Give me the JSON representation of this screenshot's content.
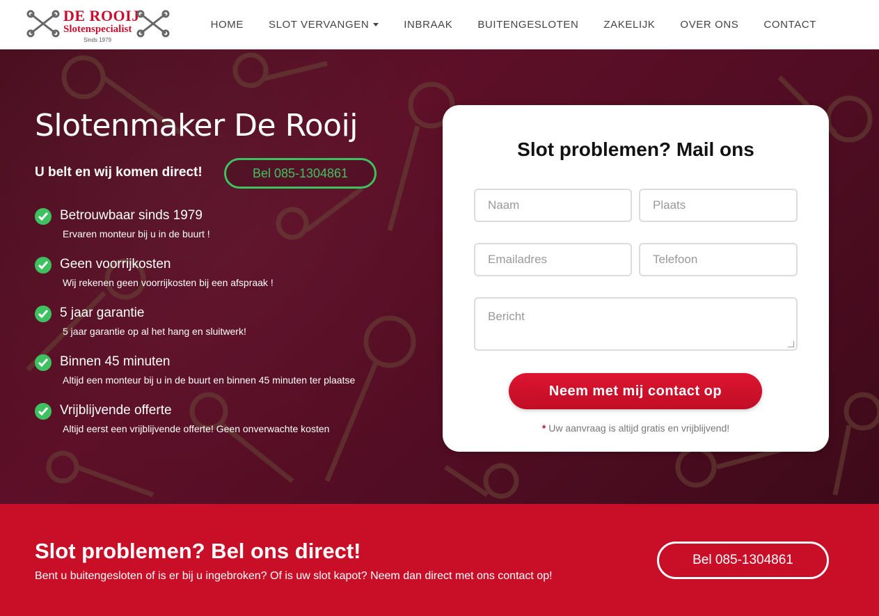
{
  "brand": {
    "name": "DE ROOIJ",
    "subtitle": "Slotenspecialist",
    "since": "Sinds 1979",
    "color": "#c8102e"
  },
  "nav": {
    "items": [
      {
        "label": "HOME"
      },
      {
        "label": "SLOT VERVANGEN",
        "has_dropdown": true
      },
      {
        "label": "INBRAAK"
      },
      {
        "label": "BUITENGESLOTEN"
      },
      {
        "label": "ZAKELIJK"
      },
      {
        "label": "OVER ONS"
      },
      {
        "label": "CONTACT"
      }
    ]
  },
  "hero": {
    "title": "Slotenmaker De Rooij",
    "call_text": "U belt en wij komen direct!",
    "call_button": "Bel 085-1304861",
    "accent_color": "#3ec261",
    "features": [
      {
        "title": "Betrouwbaar sinds 1979",
        "subtitle": "Ervaren monteur bij u in de buurt !"
      },
      {
        "title": "Geen voorrijkosten",
        "subtitle": "Wij rekenen geen voorrijkosten bij een afspraak !"
      },
      {
        "title": "5 jaar garantie",
        "subtitle": "5 jaar garantie op al het hang en sluitwerk!"
      },
      {
        "title": "Binnen 45 minuten",
        "subtitle": "Altijd een monteur bij u in de buurt en binnen 45 minuten ter plaatse"
      },
      {
        "title": "Vrijblijvende offerte",
        "subtitle": "Altijd eerst een vrijblijvende offerte! Geen onverwachte kosten"
      }
    ]
  },
  "form": {
    "title": "Slot problemen? Mail ons",
    "name_placeholder": "Naam",
    "city_placeholder": "Plaats",
    "email_placeholder": "Emailadres",
    "phone_placeholder": "Telefoon",
    "message_placeholder": "Bericht",
    "submit_label": "Neem met mij contact op",
    "note_star": "*",
    "note": "Uw aanvraag is altijd gratis en vrijblijvend!"
  },
  "cta": {
    "title": "Slot problemen? Bel ons direct!",
    "subtitle": "Bent u buitengesloten of is er bij u ingebroken? Of is uw slot kapot? Neem dan direct met ons contact op!",
    "button": "Bel 085-1304861",
    "background": "#c90f28"
  }
}
